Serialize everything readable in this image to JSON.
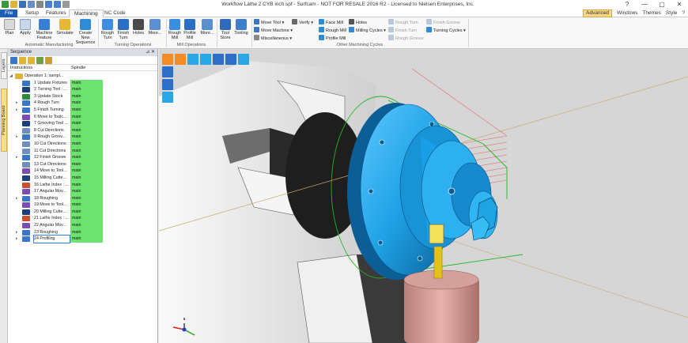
{
  "window": {
    "title": "Workflow Lathe 2 CYB inch.spf - Surfcam - NOT FOR RESALE 2016 R2  -  Licensed to Nielsen Enterprises, Inc.",
    "controls": [
      "?",
      "—",
      "▢",
      "✕"
    ]
  },
  "tabs": {
    "items": [
      "File",
      "Setup",
      "Features",
      "Machining",
      "NC Code"
    ],
    "active": "Machining",
    "right": [
      "Advanced",
      "Windows",
      "Themes",
      "Style",
      "?"
    ]
  },
  "ribbon": {
    "automatic": {
      "label": "Automatic Manufacturing",
      "buttons": [
        "Plan",
        "Apply",
        "Machine Feature",
        "Simulate",
        "Create New Sequence"
      ]
    },
    "turning": {
      "label": "Turning Operations",
      "buttons": [
        "Rough Turn",
        "Finish Turn",
        "Holes",
        "More..."
      ]
    },
    "mill": {
      "label": "Mill Operations",
      "buttons": [
        "Rough Mill",
        "Profile Mill",
        "More..."
      ]
    },
    "tools": {
      "buttons": [
        "Tool Store",
        "Tooling"
      ]
    },
    "other": {
      "label": "Other Machining Cycles",
      "col1": [
        "Move Tool",
        "Move Machine",
        "Miscellaneous"
      ],
      "col2": [
        "Verify"
      ],
      "col3": [
        "Face Mill",
        "Rough Mill",
        "Profile Mill"
      ],
      "col4": [
        "Holes",
        "Milling Cycles"
      ],
      "col5": [
        "Rough Turn",
        "Finish Turn",
        "Rough Groove"
      ],
      "col6": [
        "Finish Groove",
        "Turning Cycles"
      ]
    }
  },
  "sidetabs": [
    "Layers",
    "Planning Board"
  ],
  "sequence": {
    "title": "Sequence",
    "columns": {
      "instructions": "Instructions",
      "spindle": "Spindle"
    },
    "root": "Operation 1: sampl...",
    "rows": [
      {
        "label": "1 Update Fixtures",
        "spindle": "main",
        "color": "#3a76c8"
      },
      {
        "label": "2 Turning Tool : ...",
        "spindle": "main",
        "color": "#1e3f7a"
      },
      {
        "label": "3 Update Stock",
        "spindle": "main",
        "color": "#2f8a3c"
      },
      {
        "label": "4 Rough Turn",
        "spindle": "main",
        "color": "#3a76c8"
      },
      {
        "label": "5 Finish Turning",
        "spindle": "main",
        "color": "#3a76c8"
      },
      {
        "label": "6 Move to Toolc...",
        "spindle": "main",
        "color": "#7b4fb0"
      },
      {
        "label": "7 Grooving Tool ...",
        "spindle": "main",
        "color": "#1e3f7a"
      },
      {
        "label": "8 Cut Directions",
        "spindle": "main",
        "color": "#6d8fbf"
      },
      {
        "label": "9 Rough Groov...",
        "spindle": "main",
        "color": "#3a76c8"
      },
      {
        "label": "10 Cut Directions",
        "spindle": "main",
        "color": "#6d8fbf"
      },
      {
        "label": "11 Cut Directions",
        "spindle": "main",
        "color": "#6d8fbf"
      },
      {
        "label": "12 Finish Groove",
        "spindle": "main",
        "color": "#3a76c8"
      },
      {
        "label": "13 Cut Directions",
        "spindle": "main",
        "color": "#6d8fbf"
      },
      {
        "label": "14 Move to Tool...",
        "spindle": "main",
        "color": "#7b4fb0"
      },
      {
        "label": "15 Milling Cutte...",
        "spindle": "main",
        "color": "#1e3f7a"
      },
      {
        "label": "16 Lathe Index : ...",
        "spindle": "main",
        "color": "#c94f2e"
      },
      {
        "label": "17 Angular Mov...",
        "spindle": "main",
        "color": "#7b4fb0"
      },
      {
        "label": "18 Roughing",
        "spindle": "main",
        "color": "#3a76c8"
      },
      {
        "label": "19 Move to Tool...",
        "spindle": "main",
        "color": "#7b4fb0"
      },
      {
        "label": "20 Milling Cutte...",
        "spindle": "main",
        "color": "#1e3f7a"
      },
      {
        "label": "21 Lathe Index : ...",
        "spindle": "main",
        "color": "#c94f2e"
      },
      {
        "label": "22 Angular Mov...",
        "spindle": "main",
        "color": "#7b4fb0"
      },
      {
        "label": "23 Roughing",
        "spindle": "main",
        "color": "#3a76c8"
      },
      {
        "label": "24 Profiling",
        "spindle": "main",
        "color": "#3a76c8"
      }
    ]
  },
  "viewport": {
    "tools": [
      "view-box-icon",
      "stock-icon",
      "fixture-icon",
      "tool-icon",
      "zoom-icon",
      "list-icon",
      "axes-icon",
      "iso-view-icon",
      "top-view-icon",
      "front-view-icon",
      "right-view-icon"
    ],
    "colors": {
      "background": "#d6d6d6",
      "part": "#1fa3e6",
      "part_dark": "#0e6fb0",
      "chuck_light": "#f0f0f0",
      "chuck_dark": "#2b2b2b",
      "toolpath": "#21b821",
      "stock_lines": "#e06b6b",
      "tool_body": "#d99b96",
      "tool_tip": "#e3c21a"
    }
  }
}
